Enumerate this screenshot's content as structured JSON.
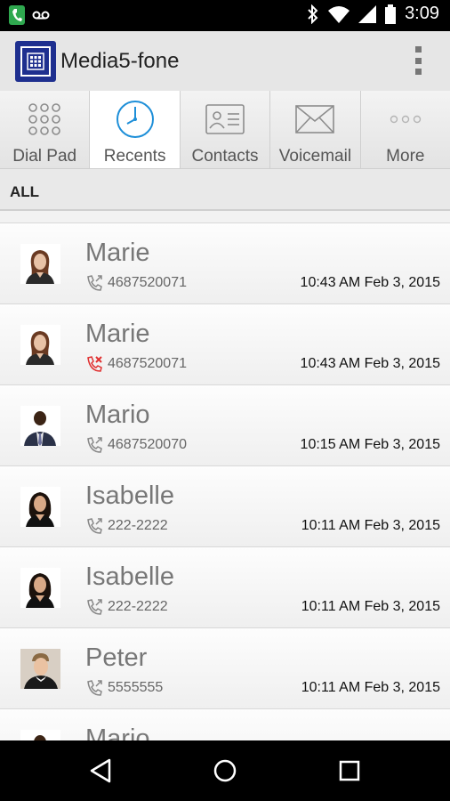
{
  "status_bar": {
    "time": "3:09"
  },
  "app": {
    "title": "Media5-fone"
  },
  "tabs": [
    {
      "label": "Dial Pad",
      "icon": "dial-pad-icon",
      "active": false
    },
    {
      "label": "Recents",
      "icon": "clock-icon",
      "active": true
    },
    {
      "label": "Contacts",
      "icon": "contact-card-icon",
      "active": false
    },
    {
      "label": "Voicemail",
      "icon": "envelope-icon",
      "active": false
    },
    {
      "label": "More",
      "icon": "ellipsis-icon",
      "active": false
    }
  ],
  "section": {
    "label": "ALL"
  },
  "calls": [
    {
      "name": "Marie",
      "number": "4687520071",
      "time": "10:43 AM Feb 3, 2015",
      "type": "outgoing"
    },
    {
      "name": "Marie",
      "number": "4687520071",
      "time": "10:43 AM Feb 3, 2015",
      "type": "missed"
    },
    {
      "name": "Mario",
      "number": "4687520070",
      "time": "10:15 AM Feb 3, 2015",
      "type": "outgoing"
    },
    {
      "name": "Isabelle",
      "number": "222-2222",
      "time": "10:11 AM Feb 3, 2015",
      "type": "outgoing"
    },
    {
      "name": "Isabelle",
      "number": "222-2222",
      "time": "10:11 AM Feb 3, 2015",
      "type": "outgoing"
    },
    {
      "name": "Peter",
      "number": "5555555",
      "time": "10:11 AM Feb 3, 2015",
      "type": "outgoing"
    },
    {
      "name": "Mario",
      "number": "",
      "time": "",
      "type": "outgoing"
    }
  ],
  "colors": {
    "accent": "#1e8fd8",
    "logo": "#1e2f8f",
    "missed": "#e03030"
  }
}
